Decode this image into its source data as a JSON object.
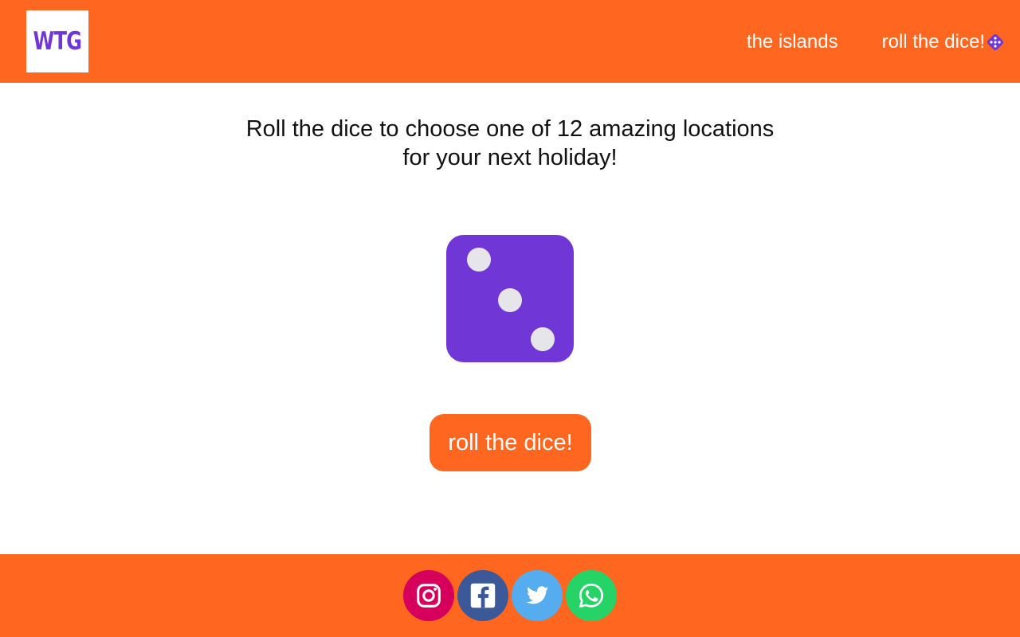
{
  "header": {
    "logo_text": "WTG",
    "nav": [
      {
        "label": "the islands"
      },
      {
        "label": "roll the dice!",
        "icon": "dice-icon"
      }
    ]
  },
  "main": {
    "intro_line1": "Roll the dice to choose one of 12 amazing locations",
    "intro_line2": "for your next holiday!",
    "dice": {
      "face_value": 3,
      "color": "#7137d6",
      "pip_color": "#e6e6ea"
    },
    "roll_button_label": "roll the dice!"
  },
  "footer": {
    "social": [
      {
        "name": "instagram-icon",
        "color": "#d6005c"
      },
      {
        "name": "facebook-icon",
        "color": "#3b5998"
      },
      {
        "name": "twitter-icon",
        "color": "#55acee"
      },
      {
        "name": "whatsapp-icon",
        "color": "#25d366"
      }
    ]
  },
  "colors": {
    "accent": "#ff661f",
    "brand": "#7137d6"
  }
}
